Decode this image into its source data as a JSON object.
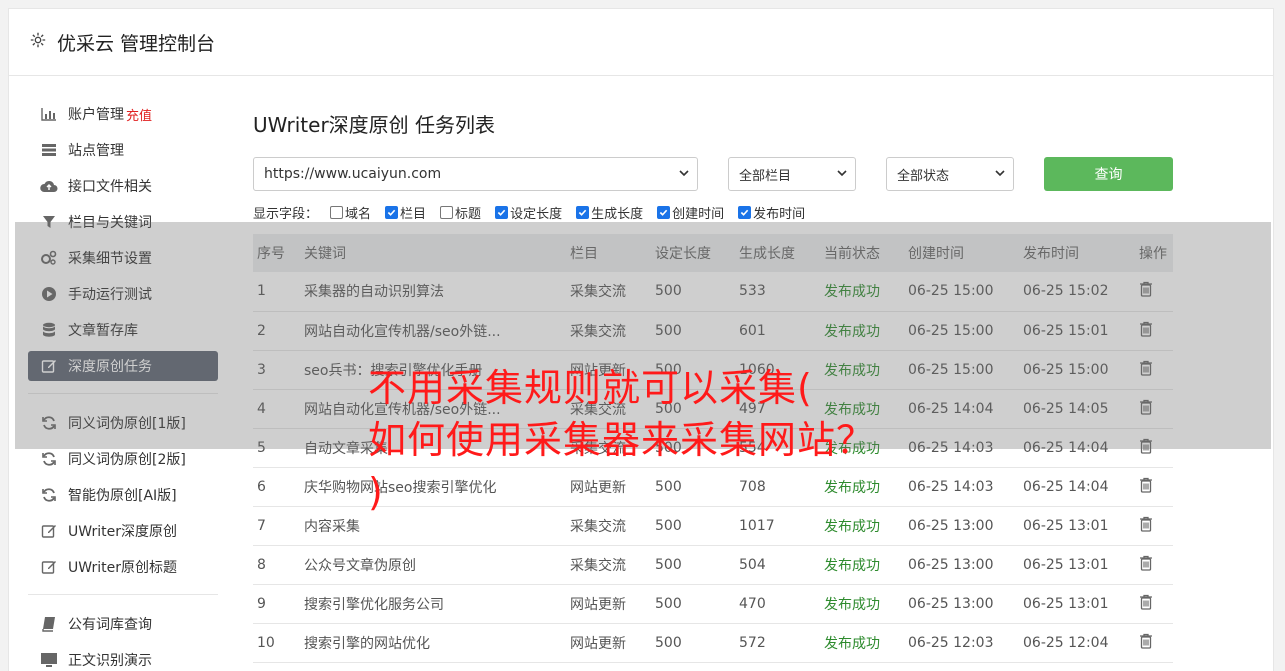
{
  "header": {
    "title": "优采云 管理控制台",
    "icon": "gear-icon"
  },
  "sidebar": {
    "group1": [
      {
        "label": "账户管理",
        "extra": "充值",
        "icon": "bar-chart-icon"
      },
      {
        "label": "站点管理",
        "icon": "server-icon"
      },
      {
        "label": "接口文件相关",
        "icon": "cloud-upload-icon"
      },
      {
        "label": "栏目与关键词",
        "icon": "filter-icon"
      },
      {
        "label": "采集细节设置",
        "icon": "cogs-icon"
      },
      {
        "label": "手动运行测试",
        "icon": "play-circle-icon"
      },
      {
        "label": "文章暂存库",
        "icon": "database-icon"
      },
      {
        "label": "深度原创任务",
        "icon": "edit-icon",
        "active": true
      }
    ],
    "group2": [
      {
        "label": "同义词伪原创[1版]",
        "icon": "refresh-icon"
      },
      {
        "label": "同义词伪原创[2版]",
        "icon": "refresh-icon"
      },
      {
        "label": "智能伪原创[AI版]",
        "icon": "refresh-icon"
      },
      {
        "label": "UWriter深度原创",
        "icon": "edit-icon"
      },
      {
        "label": "UWriter原创标题",
        "icon": "edit-icon"
      }
    ],
    "group3": [
      {
        "label": "公有词库查询",
        "icon": "book-icon"
      },
      {
        "label": "正文识别演示",
        "icon": "monitor-icon"
      }
    ]
  },
  "main": {
    "title": "UWriter深度原创 任务列表",
    "site_select": "https://www.ucaiyun.com",
    "column_select": "全部栏目",
    "status_select": "全部状态",
    "query_label": "查询",
    "fields_label": "显示字段：",
    "fields": [
      {
        "label": "域名",
        "checked": false
      },
      {
        "label": "栏目",
        "checked": true
      },
      {
        "label": "标题",
        "checked": false
      },
      {
        "label": "设定长度",
        "checked": true
      },
      {
        "label": "生成长度",
        "checked": true
      },
      {
        "label": "创建时间",
        "checked": true
      },
      {
        "label": "发布时间",
        "checked": true
      }
    ],
    "table": {
      "headers": [
        "序号",
        "关键词",
        "栏目",
        "设定长度",
        "生成长度",
        "当前状态",
        "创建时间",
        "发布时间",
        "操作"
      ],
      "rows": [
        [
          "1",
          "采集器的自动识别算法",
          "采集交流",
          "500",
          "533",
          "发布成功",
          "06-25 15:00",
          "06-25 15:02"
        ],
        [
          "2",
          "网站自动化宣传机器/seo外链...",
          "采集交流",
          "500",
          "601",
          "发布成功",
          "06-25 15:00",
          "06-25 15:01"
        ],
        [
          "3",
          "seo兵书：搜索引擎优化手册",
          "网站更新",
          "500",
          "1060",
          "发布成功",
          "06-25 15:00",
          "06-25 15:00"
        ],
        [
          "4",
          "网站自动化宣传机器/seo外链...",
          "采集交流",
          "500",
          "497",
          "发布成功",
          "06-25 14:04",
          "06-25 14:05"
        ],
        [
          "5",
          "自动文章采集",
          "采集交流",
          "500",
          "554",
          "发布成功",
          "06-25 14:03",
          "06-25 14:04"
        ],
        [
          "6",
          "庆华购物网站seo搜索引擎优化",
          "网站更新",
          "500",
          "708",
          "发布成功",
          "06-25 14:03",
          "06-25 14:04"
        ],
        [
          "7",
          "内容采集",
          "采集交流",
          "500",
          "1017",
          "发布成功",
          "06-25 13:00",
          "06-25 13:01"
        ],
        [
          "8",
          "公众号文章伪原创",
          "采集交流",
          "500",
          "504",
          "发布成功",
          "06-25 13:00",
          "06-25 13:01"
        ],
        [
          "9",
          "搜索引擎优化服务公司",
          "网站更新",
          "500",
          "470",
          "发布成功",
          "06-25 13:00",
          "06-25 13:01"
        ],
        [
          "10",
          "搜索引擎的网站优化",
          "网站更新",
          "500",
          "572",
          "发布成功",
          "06-25 12:03",
          "06-25 12:04"
        ]
      ]
    }
  },
  "overlay_text": {
    "line1": "不用采集规则就可以采集(",
    "line2": "如何使用采集器来采集网站？",
    "line3": ")"
  },
  "colors": {
    "active_nav": "#5e6674",
    "query_button": "#5cb85c",
    "status_success": "#2e8b2e",
    "overlay_text": "#ff1a1a",
    "recharge": "#e02020"
  }
}
